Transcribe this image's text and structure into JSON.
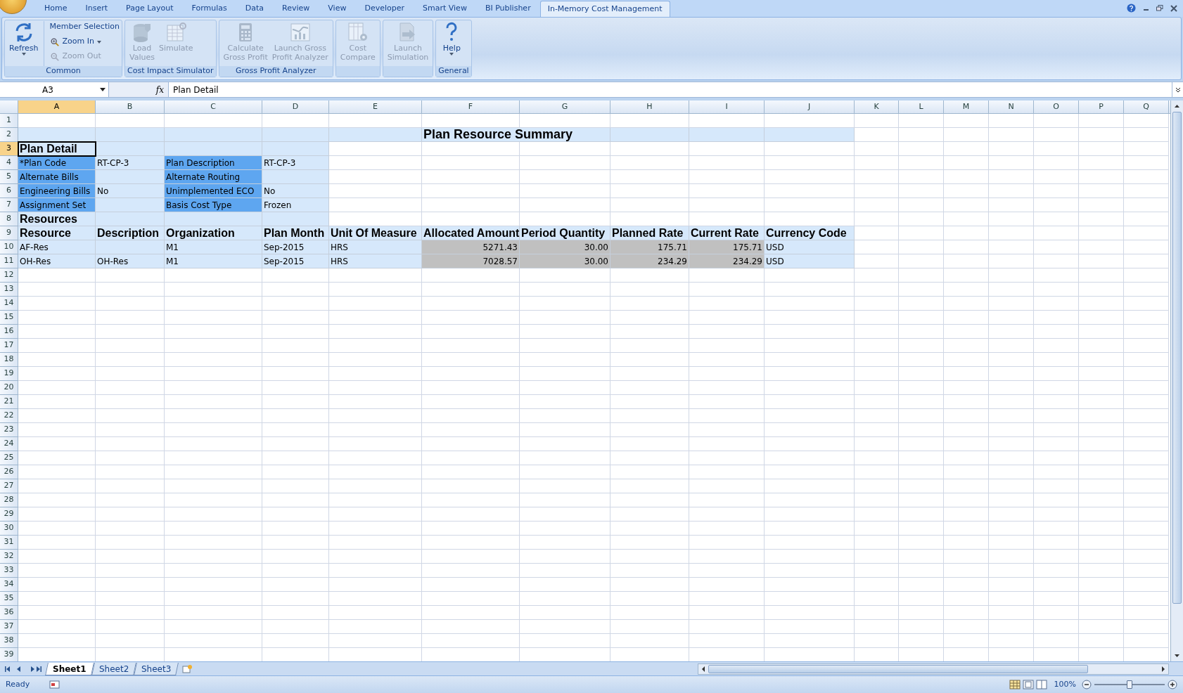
{
  "ribbon_tabs": [
    {
      "label": "Home",
      "selected": false
    },
    {
      "label": "Insert",
      "selected": false
    },
    {
      "label": "Page Layout",
      "selected": false
    },
    {
      "label": "Formulas",
      "selected": false
    },
    {
      "label": "Data",
      "selected": false
    },
    {
      "label": "Review",
      "selected": false
    },
    {
      "label": "View",
      "selected": false
    },
    {
      "label": "Developer",
      "selected": false
    },
    {
      "label": "Smart View",
      "selected": false
    },
    {
      "label": "BI Publisher",
      "selected": false
    },
    {
      "label": "In-Memory Cost Management",
      "selected": true
    }
  ],
  "ribbon_groups": [
    {
      "title": "Common",
      "buttons": [
        {
          "kind": "large",
          "label": "Refresh",
          "disabled": false,
          "dropdown": true
        },
        {
          "kind": "small",
          "label": "Member Selection",
          "disabled": false,
          "dropdown": false
        },
        {
          "kind": "small",
          "label": "Zoom In",
          "disabled": false,
          "dropdown": true
        },
        {
          "kind": "small",
          "label": "Zoom Out",
          "disabled": true,
          "dropdown": false
        }
      ]
    },
    {
      "title": "Cost Impact Simulator",
      "buttons": [
        {
          "kind": "large",
          "label": "Load\nValues",
          "disabled": true,
          "dropdown": false
        },
        {
          "kind": "large",
          "label": "Simulate",
          "disabled": true,
          "dropdown": false
        }
      ]
    },
    {
      "title": "Gross Profit Analyzer",
      "buttons": [
        {
          "kind": "large",
          "label": "Calculate\nGross Profit",
          "disabled": true,
          "dropdown": false
        },
        {
          "kind": "large",
          "label": "Launch Gross\nProfit Analyzer",
          "disabled": true,
          "dropdown": false
        }
      ]
    },
    {
      "buttons": [
        {
          "kind": "large",
          "label": "Cost\nCompare",
          "disabled": true,
          "dropdown": false
        }
      ]
    },
    {
      "buttons": [
        {
          "kind": "large",
          "label": "Launch\nSimulation",
          "disabled": true,
          "dropdown": false
        }
      ]
    },
    {
      "title": "General",
      "buttons": [
        {
          "kind": "large",
          "label": "Help",
          "disabled": false,
          "dropdown": true
        }
      ]
    }
  ],
  "name_box": "A3",
  "function_button": "fx",
  "formula": "Plan Detail",
  "columns": [
    {
      "label": "A",
      "selected": true
    },
    {
      "label": "B",
      "selected": false
    },
    {
      "label": "C",
      "selected": false
    },
    {
      "label": "D",
      "selected": false
    },
    {
      "label": "E",
      "selected": false
    },
    {
      "label": "F",
      "selected": false
    },
    {
      "label": "G",
      "selected": false
    },
    {
      "label": "H",
      "selected": false
    },
    {
      "label": "I",
      "selected": false
    },
    {
      "label": "J",
      "selected": false
    },
    {
      "label": "K",
      "selected": false
    },
    {
      "label": "L",
      "selected": false
    },
    {
      "label": "M",
      "selected": false
    },
    {
      "label": "N",
      "selected": false
    },
    {
      "label": "O",
      "selected": false
    },
    {
      "label": "P",
      "selected": false
    },
    {
      "label": "Q",
      "selected": false
    }
  ],
  "rows": [
    {
      "number": "1",
      "selected": false
    },
    {
      "number": "2",
      "selected": false,
      "cells": [
        {
          "kind": "blank",
          "selected": false
        },
        {
          "kind": "blank",
          "selected": false
        },
        {
          "kind": "blank",
          "selected": false
        },
        {
          "kind": "blank",
          "selected": false
        },
        {
          "kind": "blank",
          "selected": false
        },
        {
          "kind": "title",
          "text": "Plan Resource Summary",
          "selected": false
        },
        {
          "kind": "blank",
          "selected": false
        },
        {
          "kind": "blank",
          "selected": false
        },
        {
          "kind": "blank",
          "selected": false
        }
      ]
    },
    {
      "number": "3",
      "selected": true,
      "cells": [
        {
          "kind": "heading",
          "text": "Plan Detail",
          "selected": true
        },
        {
          "kind": "blank",
          "selected": false
        },
        {
          "kind": "blank",
          "selected": false
        },
        {
          "kind": "blank",
          "selected": false
        }
      ]
    },
    {
      "number": "4",
      "selected": false,
      "cells": [
        {
          "kind": "label",
          "text": "*Plan Code",
          "selected": false
        },
        {
          "kind": "value",
          "text": "RT-CP-3",
          "selected": false
        },
        {
          "kind": "label",
          "text": "Plan Description",
          "selected": false
        },
        {
          "kind": "value",
          "text": "RT-CP-3",
          "selected": false
        }
      ]
    },
    {
      "number": "5",
      "selected": false,
      "cells": [
        {
          "kind": "label",
          "text": "Alternate Bills",
          "selected": false
        },
        {
          "kind": "blank",
          "selected": false
        },
        {
          "kind": "label",
          "text": "Alternate Routing",
          "selected": false
        },
        {
          "kind": "blank",
          "selected": false
        }
      ]
    },
    {
      "number": "6",
      "selected": false,
      "cells": [
        {
          "kind": "label",
          "text": "Engineering Bills",
          "selected": false
        },
        {
          "kind": "value",
          "text": "No",
          "selected": false
        },
        {
          "kind": "label",
          "text": "Unimplemented ECO",
          "selected": false
        },
        {
          "kind": "value",
          "text": "No",
          "selected": false
        }
      ]
    },
    {
      "number": "7",
      "selected": false,
      "cells": [
        {
          "kind": "label",
          "text": "Assignment Set",
          "selected": false
        },
        {
          "kind": "blank",
          "selected": false
        },
        {
          "kind": "label",
          "text": "Basis Cost Type",
          "selected": false
        },
        {
          "kind": "value",
          "text": "Frozen",
          "selected": false
        }
      ]
    },
    {
      "number": "8",
      "selected": false,
      "cells": [
        {
          "kind": "heading",
          "text": "Resources",
          "selected": false
        },
        {
          "kind": "blank",
          "selected": false
        },
        {
          "kind": "blank",
          "selected": false
        },
        {
          "kind": "blank",
          "selected": false
        }
      ]
    },
    {
      "number": "9",
      "selected": false,
      "cells": [
        {
          "kind": "heading",
          "text": "Resource",
          "selected": false
        },
        {
          "kind": "heading",
          "text": "Description",
          "selected": false
        },
        {
          "kind": "heading",
          "text": "Organization",
          "selected": false
        },
        {
          "kind": "heading",
          "text": "Plan Month",
          "selected": false
        },
        {
          "kind": "heading",
          "text": "Unit Of Measure",
          "selected": false
        },
        {
          "kind": "heading",
          "text": "Allocated Amount",
          "selected": false
        },
        {
          "kind": "heading",
          "text": "Period Quantity",
          "selected": false
        },
        {
          "kind": "heading",
          "text": "Planned Rate",
          "selected": false
        },
        {
          "kind": "heading",
          "text": "Current Rate",
          "selected": false
        },
        {
          "kind": "heading",
          "text": "Currency Code",
          "selected": false
        }
      ]
    },
    {
      "number": "10",
      "selected": false,
      "cells": [
        {
          "kind": "value",
          "text": "AF-Res",
          "selected": false
        },
        {
          "kind": "blank",
          "selected": false
        },
        {
          "kind": "value",
          "text": "M1",
          "selected": false
        },
        {
          "kind": "value",
          "text": "Sep-2015",
          "selected": false
        },
        {
          "kind": "value",
          "text": "HRS",
          "selected": false
        },
        {
          "kind": "number",
          "text": "5271.43",
          "selected": false
        },
        {
          "kind": "number",
          "text": "30.00",
          "selected": false
        },
        {
          "kind": "number",
          "text": "175.71",
          "selected": false
        },
        {
          "kind": "number",
          "text": "175.71",
          "selected": false
        },
        {
          "kind": "value",
          "text": "USD",
          "selected": false
        }
      ]
    },
    {
      "number": "11",
      "selected": false,
      "cells": [
        {
          "kind": "value",
          "text": "OH-Res",
          "selected": false
        },
        {
          "kind": "value",
          "text": "OH-Res",
          "selected": false
        },
        {
          "kind": "value",
          "text": "M1",
          "selected": false
        },
        {
          "kind": "value",
          "text": "Sep-2015",
          "selected": false
        },
        {
          "kind": "value",
          "text": "HRS",
          "selected": false
        },
        {
          "kind": "number",
          "text": "7028.57",
          "selected": false
        },
        {
          "kind": "number",
          "text": "30.00",
          "selected": false
        },
        {
          "kind": "number",
          "text": "234.29",
          "selected": false
        },
        {
          "kind": "number",
          "text": "234.29",
          "selected": false
        },
        {
          "kind": "value",
          "text": "USD",
          "selected": false
        }
      ]
    },
    {
      "number": "12",
      "selected": false
    },
    {
      "number": "13",
      "selected": false
    },
    {
      "number": "14",
      "selected": false
    },
    {
      "number": "15",
      "selected": false
    },
    {
      "number": "16",
      "selected": false
    },
    {
      "number": "17",
      "selected": false
    },
    {
      "number": "18",
      "selected": false
    },
    {
      "number": "19",
      "selected": false
    },
    {
      "number": "20",
      "selected": false
    },
    {
      "number": "21",
      "selected": false
    },
    {
      "number": "22",
      "selected": false
    },
    {
      "number": "23",
      "selected": false
    },
    {
      "number": "24",
      "selected": false
    },
    {
      "number": "25",
      "selected": false
    },
    {
      "number": "26",
      "selected": false
    },
    {
      "number": "27",
      "selected": false
    },
    {
      "number": "28",
      "selected": false
    },
    {
      "number": "29",
      "selected": false
    },
    {
      "number": "30",
      "selected": false
    },
    {
      "number": "31",
      "selected": false
    },
    {
      "number": "32",
      "selected": false
    },
    {
      "number": "33",
      "selected": false
    },
    {
      "number": "34",
      "selected": false
    },
    {
      "number": "35",
      "selected": false
    },
    {
      "number": "36",
      "selected": false
    },
    {
      "number": "37",
      "selected": false
    },
    {
      "number": "38",
      "selected": false
    },
    {
      "number": "39",
      "selected": false
    }
  ],
  "sheet_tabs": [
    {
      "label": "Sheet1",
      "selected": true
    },
    {
      "label": "Sheet2",
      "selected": false
    },
    {
      "label": "Sheet3",
      "selected": false
    }
  ],
  "status_bar": {
    "text": "Ready",
    "zoom": "100%",
    "zoom_slider": {
      "level": 0.5
    }
  }
}
